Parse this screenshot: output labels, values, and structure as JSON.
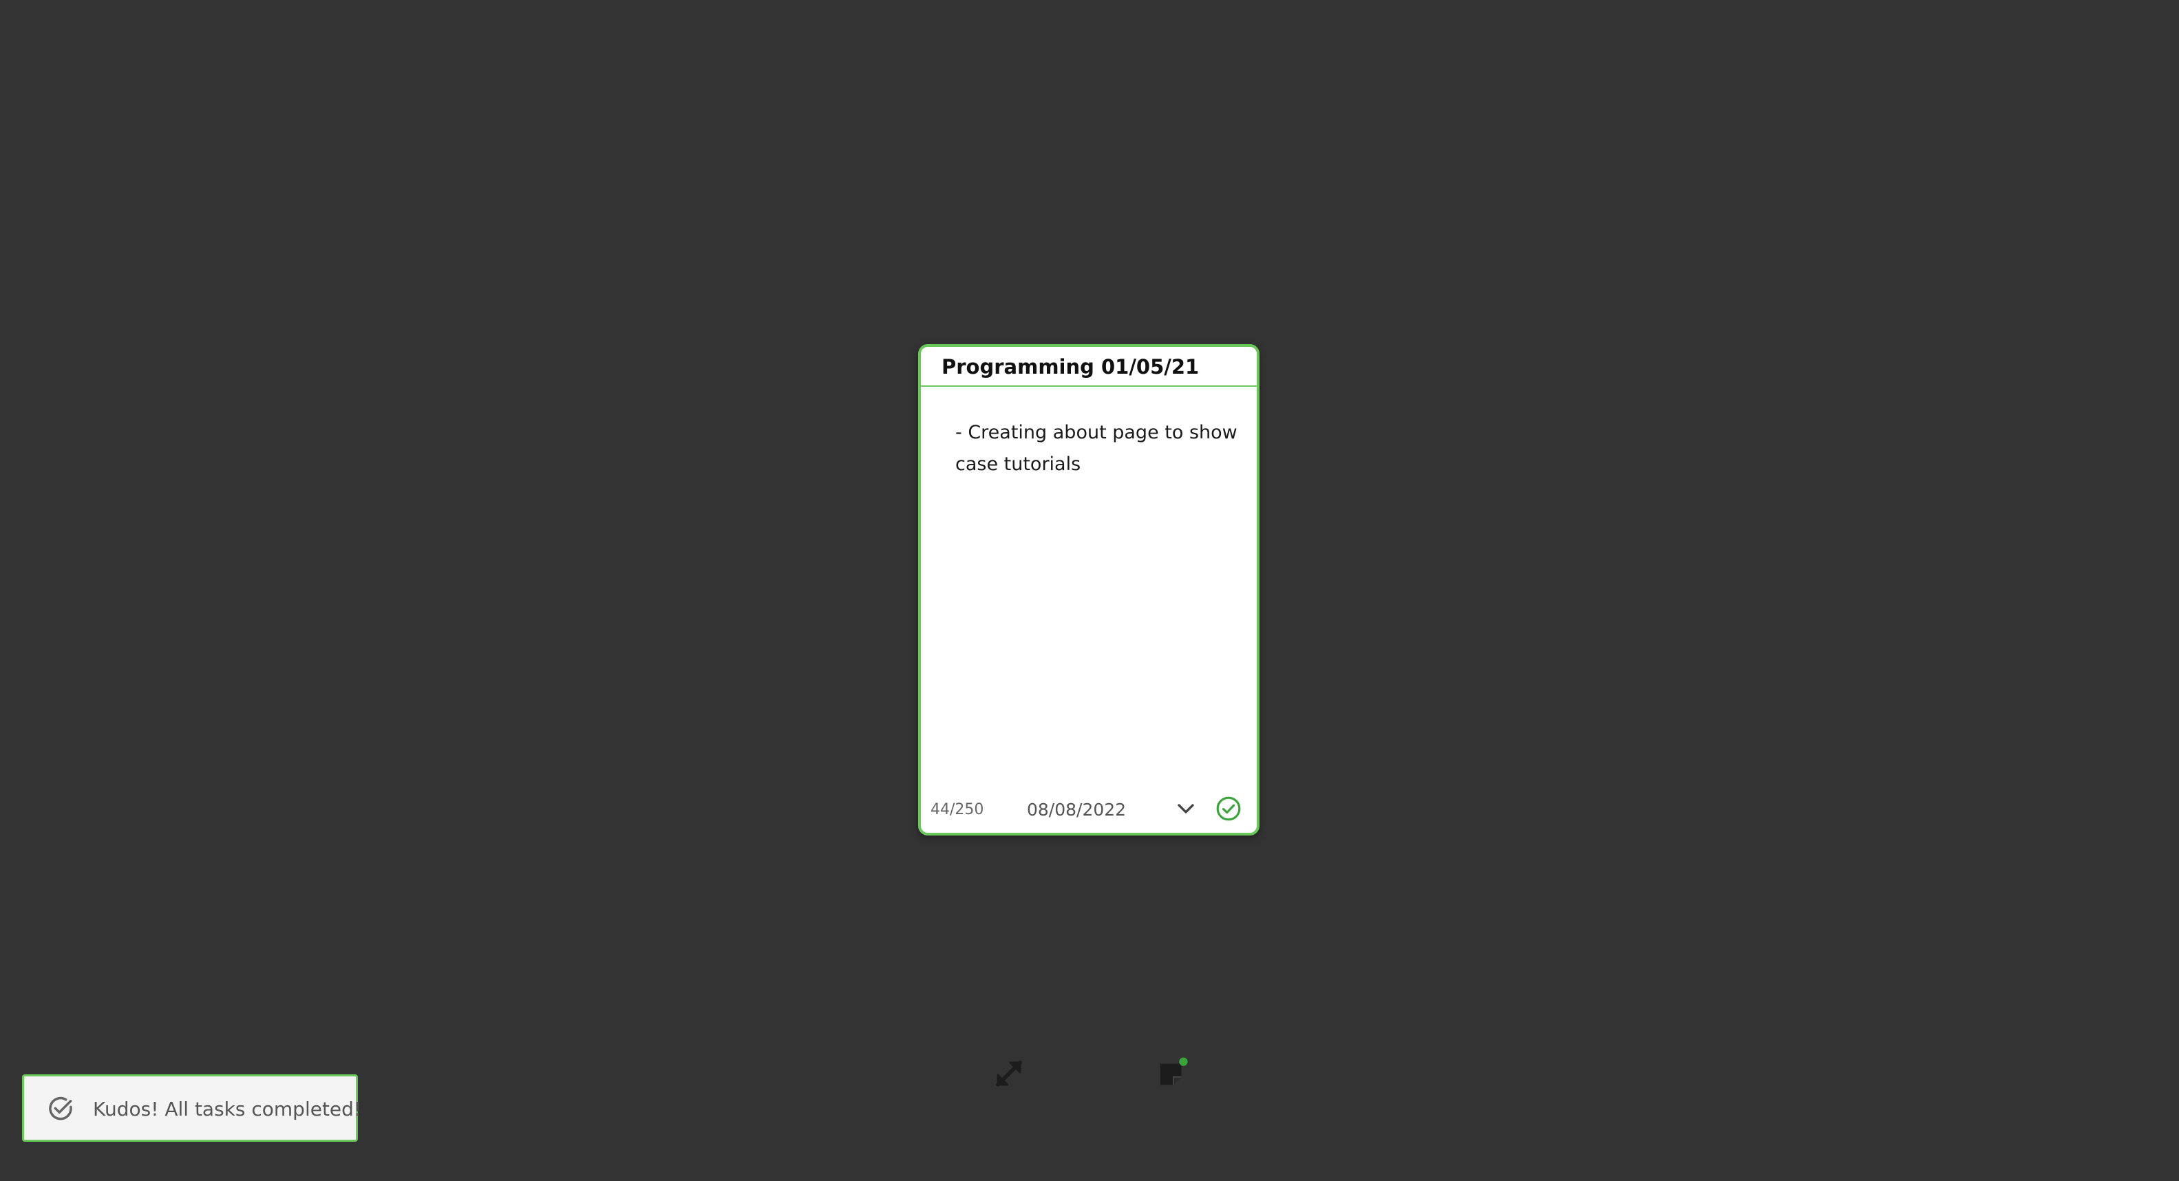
{
  "note": {
    "title": "Programming 01/05/21",
    "body": "- Creating about page to show case tutorials",
    "char_count": "44/250",
    "due_date": "08/08/2022",
    "dropdown_icon": "chevron-down-icon",
    "complete_icon": "check-circle-icon",
    "accent_color": "#6ac85a"
  },
  "toolbar": {
    "expand_icon": "expand-arrows-icon",
    "notes_icon": "sticky-note-icon",
    "badge_color": "#3aa33a"
  },
  "toast": {
    "message": "Kudos! All tasks completed!",
    "icon": "check-circle-icon"
  },
  "colors": {
    "background": "#333333",
    "card": "#ffffff",
    "success": "#3aa33a"
  }
}
